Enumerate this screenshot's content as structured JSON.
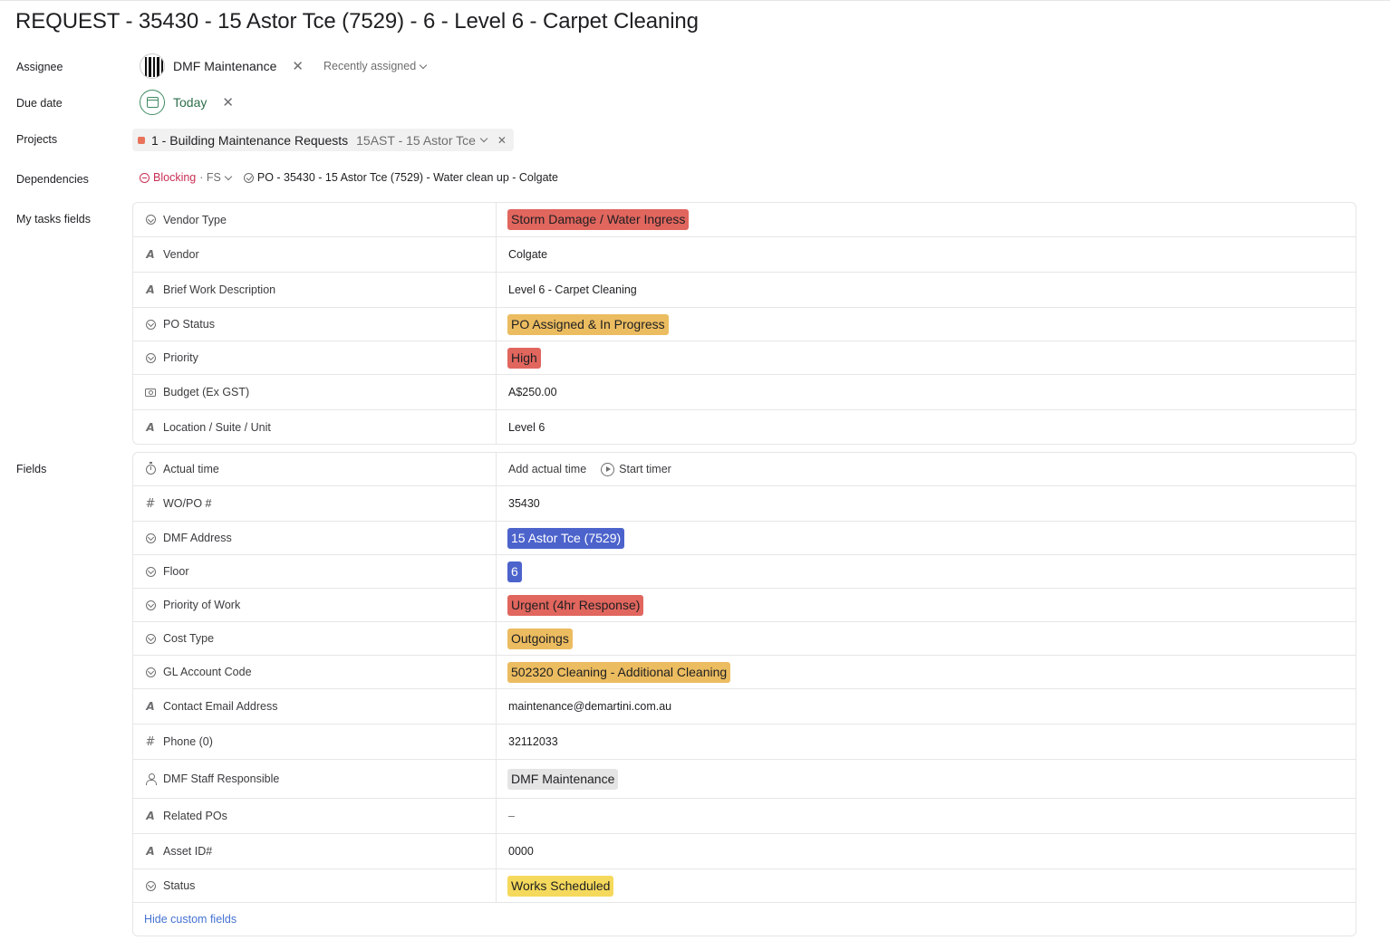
{
  "task": {
    "title": "REQUEST - 35430 - 15 Astor Tce (7529) - 6 - Level 6 - Carpet Cleaning"
  },
  "labels": {
    "assignee": "Assignee",
    "due_date": "Due date",
    "projects": "Projects",
    "dependencies": "Dependencies",
    "my_tasks_fields": "My tasks fields",
    "fields": "Fields"
  },
  "assignee": {
    "name": "DMF Maintenance",
    "recently_assigned": "Recently assigned"
  },
  "due_date": {
    "value": "Today",
    "color": "#3f8a61"
  },
  "project": {
    "name": "1 - Building Maintenance Requests",
    "section": "15AST - 15 Astor Tce",
    "color": "#e8735a"
  },
  "dependency": {
    "type": "Blocking",
    "link_type": "· FS",
    "task": "PO - 35430 - 15 Astor Tce (7529) - Water clean up - Colgate"
  },
  "my_tasks_fields": [
    {
      "name": "Vendor Type",
      "icon": "dropdown-icon",
      "value": "Storm Damage / Water Ingress",
      "pill_color": "#e1665e"
    },
    {
      "name": "Vendor",
      "icon": "text-icon",
      "value": "Colgate"
    },
    {
      "name": "Brief Work Description",
      "icon": "text-icon",
      "value": "Level 6 - Carpet Cleaning"
    },
    {
      "name": "PO Status",
      "icon": "dropdown-icon",
      "value": "PO Assigned & In Progress",
      "pill_color": "#ecbc60"
    },
    {
      "name": "Priority",
      "icon": "dropdown-icon",
      "value": "High",
      "pill_color": "#e1665e"
    },
    {
      "name": "Budget (Ex GST)",
      "icon": "currency-icon",
      "value": "A$250.00"
    },
    {
      "name": "Location / Suite / Unit",
      "icon": "text-icon",
      "value": "Level 6"
    }
  ],
  "fields": {
    "actual_time": {
      "name": "Actual time",
      "add_label": "Add actual time",
      "timer_label": "Start timer"
    },
    "wo_po": {
      "name": "WO/PO #",
      "value": "35430"
    },
    "dmf_address": {
      "name": "DMF Address",
      "value": "15 Astor Tce (7529)",
      "pill_color": "#4c63cc"
    },
    "floor": {
      "name": "Floor",
      "value": "6",
      "pill_color": "#4c63cc"
    },
    "priority_of_work": {
      "name": "Priority of Work",
      "value": "Urgent (4hr Response)",
      "pill_color": "#e1665e"
    },
    "cost_type": {
      "name": "Cost Type",
      "value": "Outgoings",
      "pill_color": "#ecbc60"
    },
    "gl_account": {
      "name": "GL Account Code",
      "value": "502320 Cleaning - Additional Cleaning",
      "pill_color": "#ecbc60"
    },
    "contact_email": {
      "name": "Contact Email Address",
      "value": "maintenance@demartini.com.au"
    },
    "phone": {
      "name": "Phone (0)",
      "value": "32112033"
    },
    "staff": {
      "name": "DMF Staff Responsible",
      "value": "DMF Maintenance",
      "pill_color": "#e5e5e5"
    },
    "related_pos": {
      "name": "Related POs",
      "value": "–"
    },
    "asset_id": {
      "name": "Asset ID#",
      "value": "0000"
    },
    "status": {
      "name": "Status",
      "value": "Works Scheduled",
      "pill_color": "#f5d95c"
    },
    "hide_link": "Hide custom fields"
  }
}
